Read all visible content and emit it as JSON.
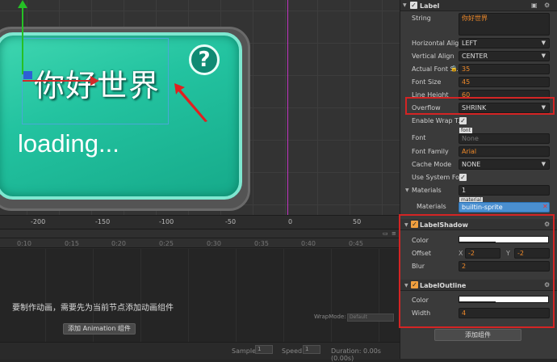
{
  "scene": {
    "ruler_labels": [
      "-200",
      "-150",
      "-100",
      "-50",
      "0",
      "50"
    ],
    "label_text": "你好世界",
    "loading_text": "loading...",
    "help_glyph": "?"
  },
  "timeline": {
    "ticks": [
      "0:10",
      "0:15",
      "0:20",
      "0:25",
      "0:30",
      "0:35",
      "0:40",
      "0:45"
    ],
    "message": "要制作动画，需要先为当前节点添加动画组件",
    "add_button": "添加 Animation 组件",
    "wrapmode_label": "WrapMode:",
    "wrapmode_value": "Default",
    "sample_label": "Sample:",
    "sample_value": "1",
    "speed_label": "Speed:",
    "speed_value": "1",
    "duration": "Duration: 0.00s (0.00s)"
  },
  "inspector": {
    "label_header": "Label",
    "string_label": "String",
    "string_value": "你好世界",
    "h_align_label": "Horizontal Align",
    "h_align_value": "LEFT",
    "v_align_label": "Vertical Align",
    "v_align_value": "CENTER",
    "actual_font_label": "Actual Font S...",
    "actual_font_value": "35",
    "font_size_label": "Font Size",
    "font_size_value": "45",
    "line_height_label": "Line Height",
    "line_height_value": "60",
    "overflow_label": "Overflow",
    "overflow_value": "SHRINK",
    "wrap_label": "Enable Wrap T...",
    "font_label": "Font",
    "font_tag": "font",
    "font_value": "None",
    "font_family_label": "Font Family",
    "font_family_value": "Arial",
    "cache_mode_label": "Cache Mode",
    "cache_mode_value": "NONE",
    "system_font_label": "Use System Font",
    "materials_label": "Materials",
    "materials_count": "1",
    "materials_item_label": "Materials",
    "material_tag": "material",
    "material_value": "builtin-sprite",
    "shadow_header": "LabelShadow",
    "shadow_color_label": "Color",
    "offset_label": "Offset",
    "offset_x_label": "X",
    "offset_x": "-2",
    "offset_y_label": "Y",
    "offset_y": "-2",
    "blur_label": "Blur",
    "blur_value": "2",
    "outline_header": "LabelOutline",
    "outline_color_label": "Color",
    "width_label": "Width",
    "width_value": "4",
    "add_component": "添加组件"
  },
  "colors": {
    "accent_orange": "#f08a2a",
    "highlight_red": "#d42424",
    "card_green": "#23c3a0"
  }
}
